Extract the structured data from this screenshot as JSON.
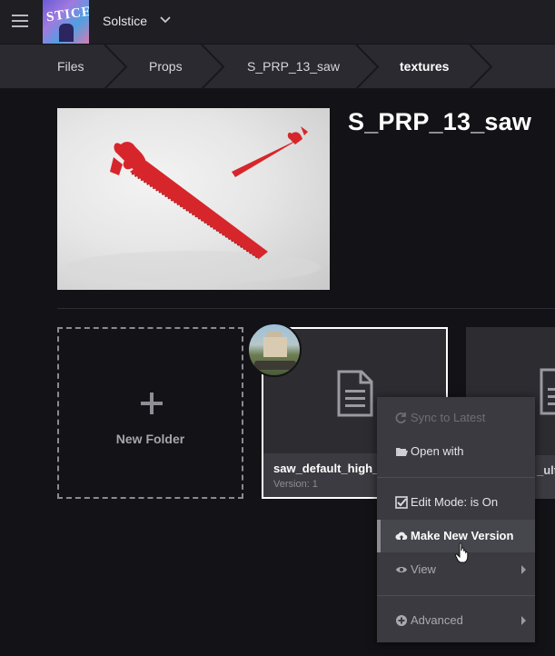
{
  "header": {
    "project_name": "Solstice",
    "thumb_text": "STICE",
    "menu_icon": "hamburger-menu-icon",
    "dropdown_icon": "chevron-down-icon"
  },
  "breadcrumb": [
    {
      "label": "Files"
    },
    {
      "label": "Props"
    },
    {
      "label": "S_PRP_13_saw"
    },
    {
      "label": "textures"
    }
  ],
  "asset": {
    "title": "S_PRP_13_saw"
  },
  "folder": {
    "new_label": "New Folder"
  },
  "files": [
    {
      "name": "saw_default_high_",
      "version": "Version: 1"
    },
    {
      "name": "_ult_"
    }
  ],
  "context_menu": {
    "items": [
      {
        "label": "Sync to Latest",
        "icon": "sync-icon",
        "state": "disabled"
      },
      {
        "label": "Open with",
        "icon": "folder-open-icon",
        "state": "normal"
      },
      {
        "label": "Edit Mode: is On",
        "icon": "checkbox-checked-icon",
        "state": "normal"
      },
      {
        "label": "Make New Version",
        "icon": "cloud-upload-icon",
        "state": "hover"
      },
      {
        "label": "View",
        "icon": "eye-icon",
        "state": "muted",
        "submenu": true
      },
      {
        "label": "Advanced",
        "icon": "plus-circle-icon",
        "state": "muted",
        "submenu": true
      }
    ]
  },
  "colors": {
    "background": "#131317",
    "topbar": "#1e1e23",
    "breadcrumb_bar": "#2a2a30",
    "card": "#2c2c31",
    "menu": "#3a3a40",
    "saw_red": "#d7262b"
  }
}
